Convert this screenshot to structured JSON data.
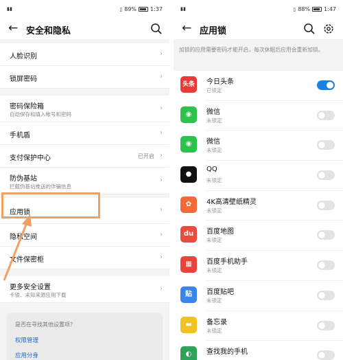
{
  "left": {
    "status": {
      "signal": "▮.▮",
      "battery": "89%",
      "time": "1:37"
    },
    "title": "安全和隐私",
    "groups": [
      [
        {
          "label": "人脸识别",
          "sub": "",
          "value": ""
        },
        {
          "label": "锁屏密码",
          "sub": "",
          "value": ""
        }
      ],
      [
        {
          "label": "密码保险箱",
          "sub": "自动保存和填入帐号和密码",
          "value": ""
        },
        {
          "label": "手机盾",
          "sub": "",
          "value": ""
        },
        {
          "label": "支付保护中心",
          "sub": "",
          "value": "已开启"
        },
        {
          "label": "防伪基站",
          "sub": "拦截伪基站推送的诈骗信息",
          "value": ""
        }
      ],
      [
        {
          "label": "应用锁",
          "sub": "",
          "value": ""
        },
        {
          "label": "隐私空间",
          "sub": "",
          "value": ""
        },
        {
          "label": "文件保密柜",
          "sub": "",
          "value": ""
        }
      ],
      [
        {
          "label": "更多安全设置",
          "sub": "卡锁、未知来源应用下载",
          "value": ""
        }
      ]
    ],
    "hint": {
      "question": "是否在寻找其他设置项？",
      "links": [
        "权限管理",
        "应用分身"
      ]
    }
  },
  "right": {
    "status": {
      "signal": "▮.▮",
      "battery": "88%",
      "time": "1:47"
    },
    "title": "应用锁",
    "description": "加锁的应用需要密码才能开启，每次休眠后应用会重新加锁。",
    "apps": [
      {
        "name": "今日头条",
        "status": "已锁定",
        "locked": true,
        "icon_text": "头条",
        "icon_color": "#e83a36"
      },
      {
        "name": "微信",
        "status": "未锁定",
        "locked": false,
        "icon_text": "◉",
        "icon_color": "#2dc14d"
      },
      {
        "name": "微信",
        "status": "未锁定",
        "locked": false,
        "icon_text": "◉",
        "icon_color": "#2dc14d"
      },
      {
        "name": "QQ",
        "status": "未锁定",
        "locked": false,
        "icon_text": "●",
        "icon_color": "#111111"
      },
      {
        "name": "4K高清壁纸精灵",
        "status": "未锁定",
        "locked": false,
        "icon_text": "✿",
        "icon_color": "#f06a3a"
      },
      {
        "name": "百度地图",
        "status": "未锁定",
        "locked": false,
        "icon_text": "du",
        "icon_color": "#e84c3d"
      },
      {
        "name": "百度手机助手",
        "status": "未锁定",
        "locked": false,
        "icon_text": "▦",
        "icon_color": "#e8443a"
      },
      {
        "name": "百度贴吧",
        "status": "未锁定",
        "locked": false,
        "icon_text": "贴",
        "icon_color": "#3a86e8"
      },
      {
        "name": "备忘录",
        "status": "未锁定",
        "locked": false,
        "icon_text": "▬",
        "icon_color": "#f2c122"
      },
      {
        "name": "查找我的手机",
        "status": "",
        "locked": false,
        "icon_text": "◐",
        "icon_color": "#2fa35a"
      }
    ]
  },
  "colors": {
    "accent": "#1a82e2",
    "highlight": "#f0a060",
    "link": "#1e6ad8"
  }
}
